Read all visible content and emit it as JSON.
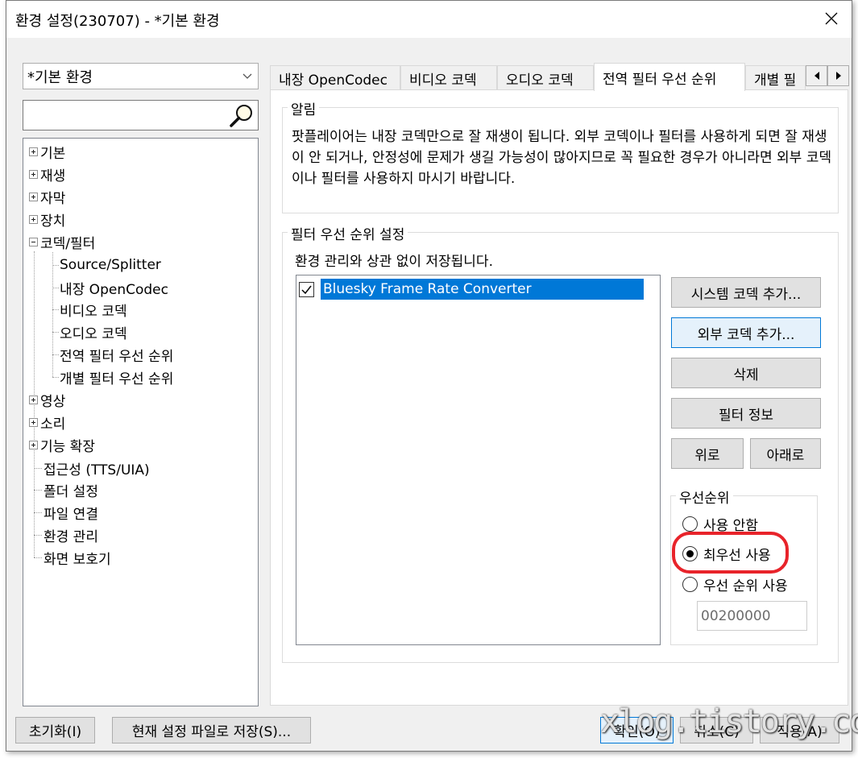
{
  "window": {
    "title": "환경 설정(230707) - *기본 환경"
  },
  "profile": {
    "selected": "*기본 환경"
  },
  "tree": {
    "items": [
      {
        "label": "기본"
      },
      {
        "label": "재생"
      },
      {
        "label": "자막"
      },
      {
        "label": "장치"
      },
      {
        "label": "코덱/필터"
      },
      {
        "label": "Source/Splitter"
      },
      {
        "label": "내장 OpenCodec"
      },
      {
        "label": "비디오 코덱"
      },
      {
        "label": "오디오 코덱"
      },
      {
        "label": "전역 필터 우선 순위"
      },
      {
        "label": "개별 필터 우선 순위"
      },
      {
        "label": "영상"
      },
      {
        "label": "소리"
      },
      {
        "label": "기능 확장"
      },
      {
        "label": "접근성 (TTS/UIA)"
      },
      {
        "label": "폴더 설정"
      },
      {
        "label": "파일 연결"
      },
      {
        "label": "환경 관리"
      },
      {
        "label": "화면 보호기"
      }
    ]
  },
  "tabs": [
    {
      "label": "내장 OpenCodec"
    },
    {
      "label": "비디오 코덱"
    },
    {
      "label": "오디오 코덱"
    },
    {
      "label": "전역 필터 우선 순위"
    },
    {
      "label": "개별 필"
    }
  ],
  "notice": {
    "title": "알림",
    "text": "팟플레이어는 내장 코덱만으로 잘 재생이 됩니다. 외부 코덱이나 필터를 사용하게 되면 잘 재생이 안 되거나, 안정성에 문제가 생길 가능성이 많아지므로 꼭 필요한 경우가 아니라면 외부 코덱이나 필터를 사용하지 마시기 바랍니다."
  },
  "filter_priority": {
    "title": "필터 우선 순위 설정",
    "subtitle": "환경 관리와 상관 없이 저장됩니다.",
    "list": [
      {
        "label": "Bluesky Frame Rate Converter",
        "checked": true
      }
    ],
    "buttons": {
      "add_system": "시스템 코덱 추가...",
      "add_external": "외부 코덱 추가...",
      "delete": "삭제",
      "info": "필터 정보",
      "up": "위로",
      "down": "아래로"
    },
    "priority": {
      "title": "우선순위",
      "options": [
        {
          "label": "사용 안함",
          "selected": false
        },
        {
          "label": "최우선 사용",
          "selected": true
        },
        {
          "label": "우선 순위 사용",
          "selected": false
        }
      ],
      "value": "00200000"
    }
  },
  "bottom": {
    "reset": "초기화(I)",
    "save_file": "현재 설정 파일로 저장(S)...",
    "ok": "확인(O)",
    "cancel": "취소(C)",
    "apply": "적용(A)"
  },
  "watermark": "xlog.tistory.com",
  "colors": {
    "selection": "#0078d7",
    "highlight": "#e8232a"
  }
}
